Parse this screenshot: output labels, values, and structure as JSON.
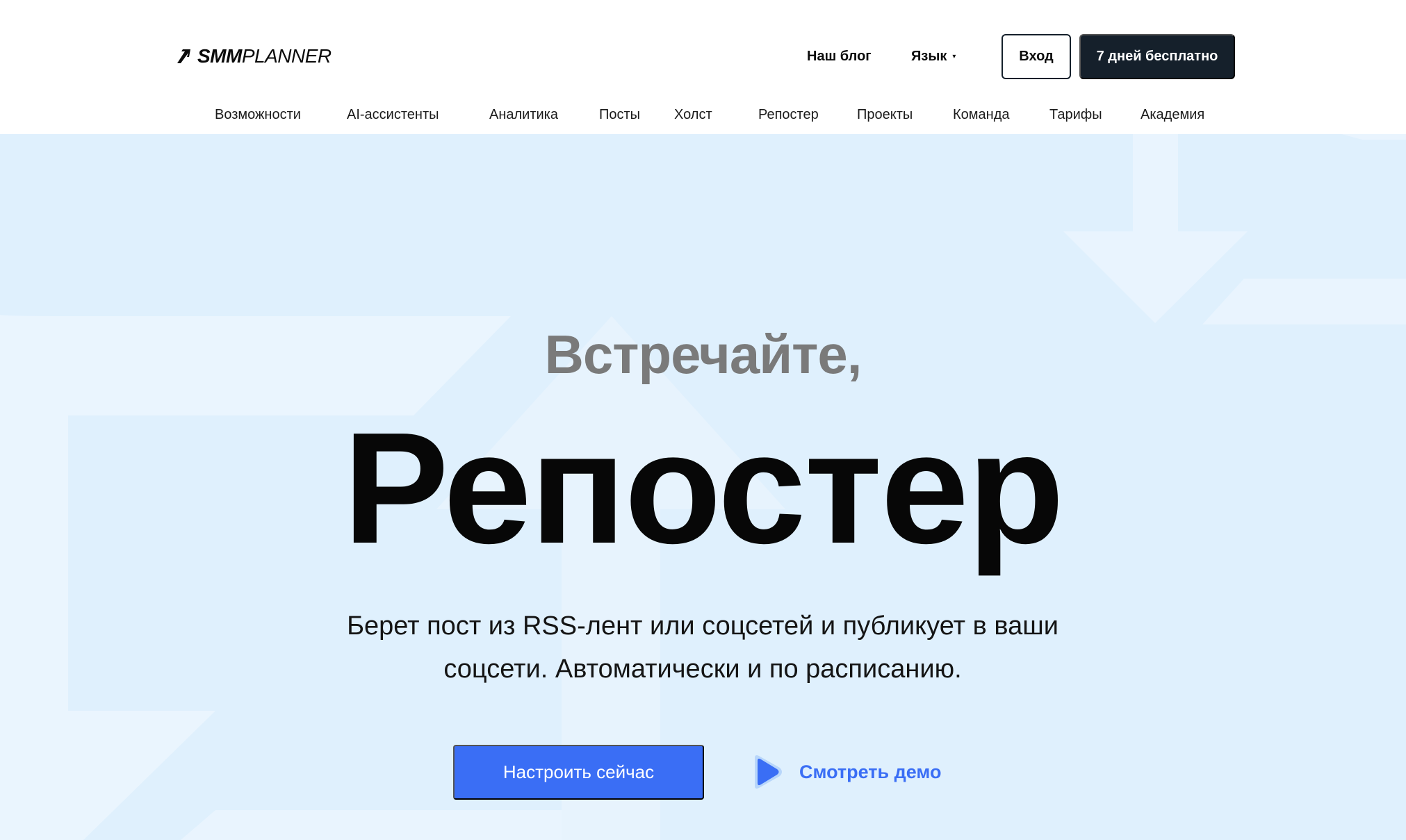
{
  "header": {
    "logo": {
      "bold": "SMM",
      "thin": "PLANNER"
    },
    "blog_label": "Наш блог",
    "language_label": "Язык",
    "login_label": "Вход",
    "trial_label": "7 дней бесплатно"
  },
  "nav": {
    "items": [
      "Возможности",
      "AI-ассистенты",
      "Аналитика",
      "Посты",
      "Холст",
      "Репостер",
      "Проекты",
      "Команда",
      "Тарифы",
      "Академия"
    ]
  },
  "hero": {
    "kicker": "Встречайте,",
    "title": "Репостер",
    "description": "Берет пост из RSS-лент или соцсетей и публикует в ваши соцсети. Автоматически и по расписанию.",
    "cta_label": "Настроить сейчас",
    "demo_label": "Смотреть демо"
  },
  "colors": {
    "hero_background": "#dff0fd",
    "accent": "#3a6ef5",
    "dark_button": "#15202b",
    "kicker_text": "#7a7a7a"
  },
  "icons": {
    "logo_mark": "arrow-up-right-icon",
    "language_caret": "caret-down-icon",
    "demo_play": "play-icon"
  }
}
